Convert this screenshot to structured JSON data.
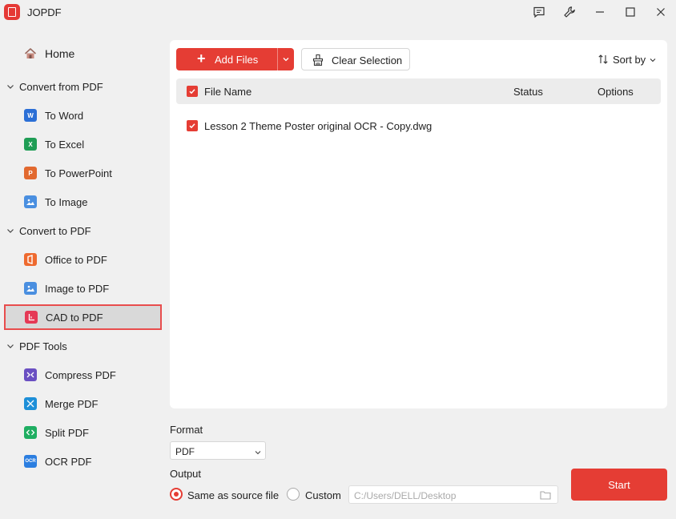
{
  "app": {
    "title": "JOPDF",
    "logo_text": "PDF"
  },
  "sidebar": {
    "home": {
      "label": "Home",
      "icon": "home-icon"
    },
    "groups": [
      {
        "label": "Convert from PDF",
        "items": [
          {
            "label": "To Word",
            "icon": "word-icon",
            "color": "#2b6fd6",
            "glyph": "W"
          },
          {
            "label": "To Excel",
            "icon": "excel-icon",
            "color": "#1f9d55",
            "glyph": "X"
          },
          {
            "label": "To PowerPoint",
            "icon": "powerpoint-icon",
            "color": "#e2692f",
            "glyph": "P"
          },
          {
            "label": "To Image",
            "icon": "image-icon",
            "color": "#4a8fe0",
            "glyph": ""
          }
        ]
      },
      {
        "label": "Convert to PDF",
        "items": [
          {
            "label": "Office to PDF",
            "icon": "office-icon",
            "color": "#ee6a2f",
            "glyph": ""
          },
          {
            "label": "Image to PDF",
            "icon": "image-icon",
            "color": "#4a8fe0",
            "glyph": ""
          },
          {
            "label": "CAD to PDF",
            "icon": "cad-icon",
            "color": "#e53956",
            "glyph": "",
            "active": true
          }
        ]
      },
      {
        "label": "PDF Tools",
        "items": [
          {
            "label": "Compress PDF",
            "icon": "compress-icon",
            "color": "#6a4fc2",
            "glyph": ""
          },
          {
            "label": "Merge PDF",
            "icon": "merge-icon",
            "color": "#1d8fd8",
            "glyph": ""
          },
          {
            "label": "Split PDF",
            "icon": "split-icon",
            "color": "#1fae62",
            "glyph": ""
          },
          {
            "label": "OCR PDF",
            "icon": "ocr-icon",
            "color": "#2b7ee0",
            "glyph": "OCR"
          }
        ]
      }
    ]
  },
  "toolbar": {
    "add_files": "Add Files",
    "clear_selection": "Clear Selection",
    "sort_by": "Sort by"
  },
  "table": {
    "columns": [
      "File Name",
      "Status",
      "Options"
    ],
    "rows": [
      {
        "file_name": "Lesson 2 Theme Poster original OCR - Copy.dwg",
        "status": "",
        "checked": true
      }
    ]
  },
  "format": {
    "label": "Format",
    "value": "PDF"
  },
  "output": {
    "label": "Output",
    "same_as_source": "Same as source file",
    "custom": "Custom",
    "selected": "same_as_source",
    "path_placeholder": "C:/Users/DELL/Desktop"
  },
  "start_label": "Start",
  "colors": {
    "accent": "#e53d34",
    "active_border": "#e84d4d"
  }
}
